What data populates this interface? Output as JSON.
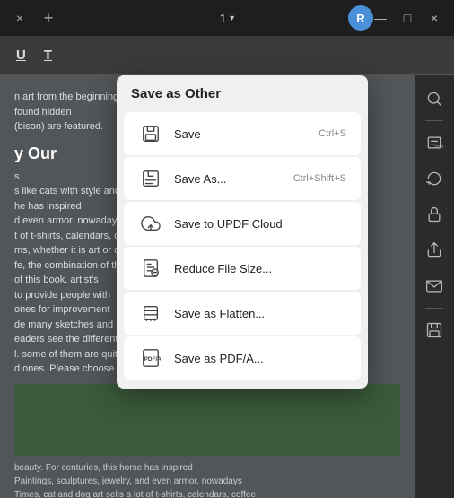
{
  "titlebar": {
    "close_icon": "×",
    "add_tab_icon": "+",
    "page_number": "1",
    "chevron": "▾",
    "user_initial": "R",
    "minimize": "—",
    "maximize": "□",
    "close_window": "×"
  },
  "toolbar": {
    "underline_label": "U",
    "text_label": "T",
    "separator": "|"
  },
  "dropdown": {
    "title": "Save as Other",
    "items": [
      {
        "id": "save",
        "label": "Save",
        "shortcut": "Ctrl+S"
      },
      {
        "id": "save-as",
        "label": "Save As...",
        "shortcut": "Ctrl+Shift+S"
      },
      {
        "id": "save-cloud",
        "label": "Save to UPDF Cloud",
        "shortcut": ""
      },
      {
        "id": "reduce-size",
        "label": "Reduce File Size...",
        "shortcut": ""
      },
      {
        "id": "save-flatten",
        "label": "Save as Flatten...",
        "shortcut": ""
      },
      {
        "id": "save-pdfa",
        "label": "Save as PDF/A...",
        "shortcut": ""
      }
    ]
  },
  "document": {
    "text1": "n art from the beginning",
    "text2": "found hidden",
    "text3": "(bison) are featured.",
    "heading": "y Our",
    "text4": "s",
    "text5": "s like cats with style and style",
    "text6": "he has inspired",
    "text7": "d even armor. nowadays",
    "text8": "t of t-shirts, calendars, coffee",
    "text9": "ms, whether it is art or domestic",
    "text10": "fe, the combination of the two",
    "text11": "of this book. artist's",
    "text12": "to provide people with",
    "text13": "ones for improvement",
    "text14": "de many sketches and",
    "text15": "eaders see the different ways",
    "text16": "l. some of them are quite",
    "text17": "d ones. Please choose",
    "caption1": "beauty. For centuries, this horse has inspired",
    "caption2": "Paintings, sculptures, jewelry, and even armor. nowadays",
    "caption3": "Times, cat and dog art sells a lot of t-shirts, calendars, coffee"
  },
  "sidebar_right": {
    "search_icon": "search",
    "ocr_icon": "ocr",
    "rotate_icon": "rotate",
    "lock_icon": "lock",
    "share_icon": "share",
    "mail_icon": "mail",
    "save_icon": "save"
  }
}
